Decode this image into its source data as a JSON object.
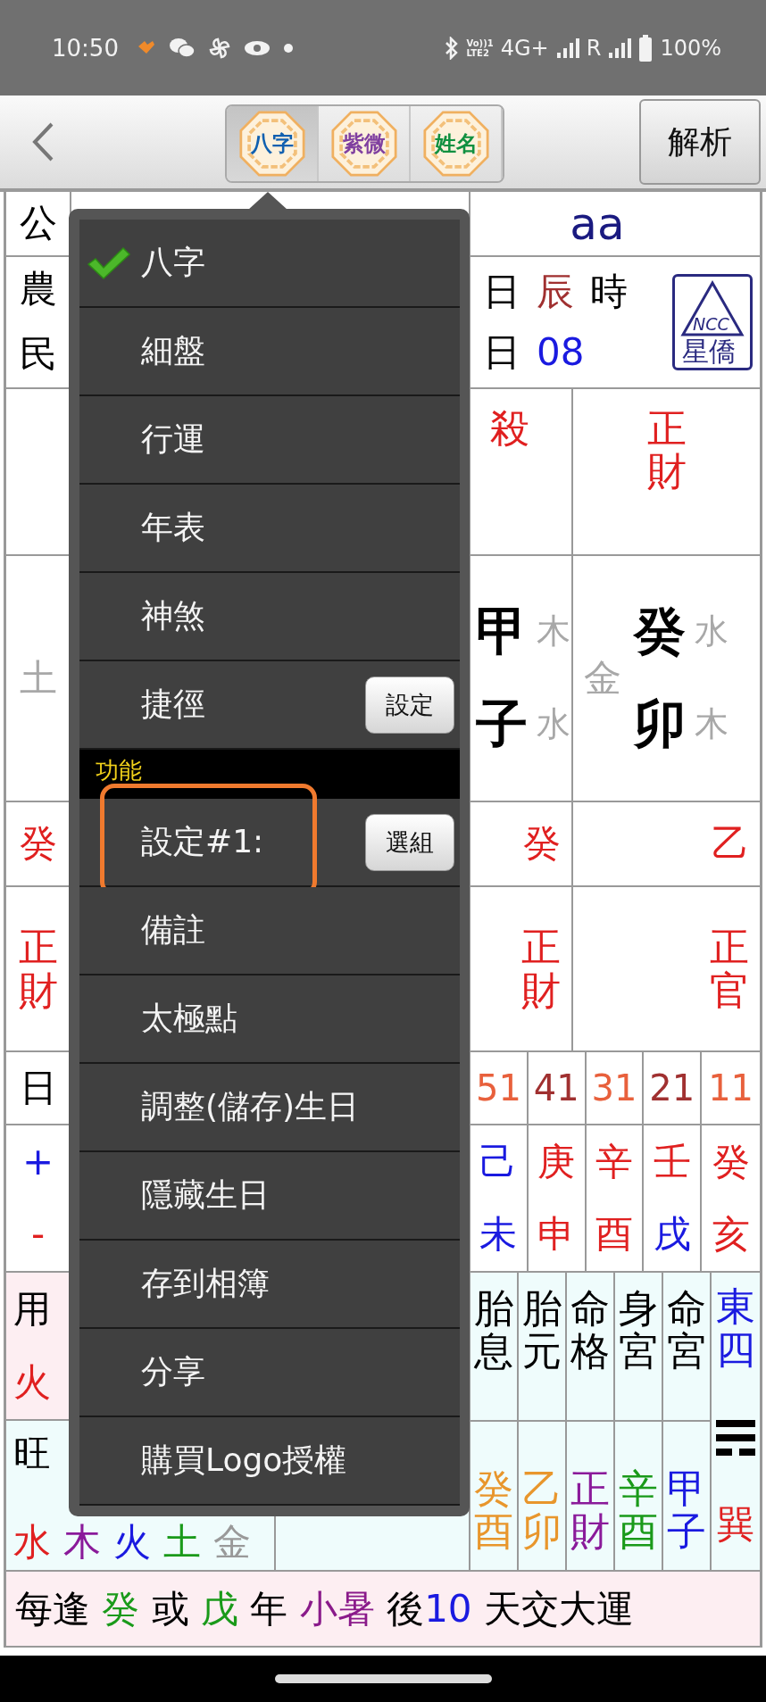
{
  "status_bar": {
    "time": "10:50",
    "volte": [
      "Vo))1",
      "LTE2"
    ],
    "network": "4G+",
    "roaming": "R",
    "battery": "100%"
  },
  "toolbar": {
    "tabs": [
      {
        "label": "八字",
        "color": "#1060b0",
        "selected": true
      },
      {
        "label": "紫微",
        "color": "#8040a0",
        "selected": false
      },
      {
        "label": "姓名",
        "color": "#109040",
        "selected": false
      }
    ],
    "analyze_button": "解析"
  },
  "chart": {
    "name": "aa",
    "calendar_labels": [
      "公",
      "農",
      "民"
    ],
    "lunar_cells": [
      {
        "text": "日"
      },
      {
        "text": "辰",
        "color": "#a03030"
      },
      {
        "text": "時"
      }
    ],
    "roc_cells": [
      {
        "text": "日"
      },
      {
        "text": "08",
        "color": "#1a1ae0"
      }
    ],
    "logo": {
      "top": "NCC",
      "bottom": "星僑"
    },
    "ten_gods": [
      "殺",
      "正財"
    ],
    "left_element": "土",
    "pillars": [
      {
        "stem": "甲",
        "stem_element": "木",
        "branch": "子",
        "branch_element": "水"
      },
      {
        "side_element": "金",
        "stem": "癸",
        "stem_element": "水",
        "branch": "卯",
        "branch_element": "木"
      }
    ],
    "hidden_stems": {
      "left": "癸",
      "cells": [
        "癸",
        "乙"
      ]
    },
    "hidden_gods": {
      "left": "正財",
      "cells": [
        "正財",
        "正官"
      ]
    },
    "luck": {
      "left": "日",
      "signs": [
        {
          "text": "+",
          "color": "#1a1ae0"
        },
        {
          "text": "-",
          "color": "#e02020"
        }
      ],
      "ages": [
        {
          "text": "51",
          "color": "#e8603c"
        },
        {
          "text": "41",
          "color": "#a03030"
        },
        {
          "text": "31",
          "color": "#e8603c"
        },
        {
          "text": "21",
          "color": "#a03030"
        },
        {
          "text": "11",
          "color": "#e8603c"
        }
      ],
      "pillars": [
        {
          "stem": {
            "text": "己",
            "color": "#1a1ae0"
          },
          "branch": {
            "text": "未",
            "color": "#1a1ae0"
          }
        },
        {
          "stem": {
            "text": "庚",
            "color": "#e02020"
          },
          "branch": {
            "text": "申",
            "color": "#e02020"
          }
        },
        {
          "stem": {
            "text": "辛",
            "color": "#e02020"
          },
          "branch": {
            "text": "酉",
            "color": "#e02020"
          }
        },
        {
          "stem": {
            "text": "壬",
            "color": "#e02020"
          },
          "branch": {
            "text": "戌",
            "color": "#1a1ae0"
          }
        },
        {
          "stem": {
            "text": "癸",
            "color": "#e02020"
          },
          "branch": {
            "text": "亥",
            "color": "#e02020"
          }
        }
      ]
    },
    "extra": {
      "use_label": "用",
      "use_value": "火",
      "strong_label": "旺",
      "elements": [
        {
          "text": "水",
          "color": "#e02020"
        },
        {
          "text": "木",
          "color": "#8a1a9a"
        },
        {
          "text": "火",
          "color": "#1a1ae0"
        },
        {
          "text": "土",
          "color": "#1a9a1a"
        },
        {
          "text": "金",
          "color": "#999999"
        }
      ],
      "labels": [
        "胎息",
        "胎元",
        "命格",
        "身宮",
        "命宮"
      ],
      "values": [
        {
          "text": "癸酉",
          "color": "#e8962c"
        },
        {
          "text": "乙卯",
          "color": "#e8962c"
        },
        {
          "text": "正財",
          "color": "#8a1a9a"
        },
        {
          "text": "辛酉",
          "color": "#1a9a1a"
        },
        {
          "text": "甲子",
          "color": "#1a1ae0"
        }
      ],
      "direction": "東四",
      "trigram_name": "巽"
    },
    "footer": [
      {
        "text": "每逢 "
      },
      {
        "text": "癸",
        "color": "#1a9a1a"
      },
      {
        "text": " 或 "
      },
      {
        "text": "戊",
        "color": "#1a9a1a"
      },
      {
        "text": " 年 "
      },
      {
        "text": "小暑",
        "color": "#8a1a8a"
      },
      {
        "text": " 後"
      },
      {
        "text": "10",
        "color": "#1a1ae0"
      },
      {
        "text": " 天交大運"
      }
    ]
  },
  "menu": {
    "items": [
      {
        "kind": "item",
        "label": "八字",
        "checked": true,
        "highlighted": false
      },
      {
        "kind": "item",
        "label": "細盤",
        "checked": false,
        "highlighted": false
      },
      {
        "kind": "item",
        "label": "行運",
        "checked": false,
        "highlighted": false
      },
      {
        "kind": "item",
        "label": "年表",
        "checked": false,
        "highlighted": false
      },
      {
        "kind": "item",
        "label": "神煞",
        "checked": false,
        "highlighted": false
      },
      {
        "kind": "item",
        "label": "捷徑",
        "button": "設定",
        "checked": false,
        "highlighted": false
      },
      {
        "kind": "section",
        "label": "功能"
      },
      {
        "kind": "item",
        "label": "設定#1:",
        "button": "選組",
        "checked": false,
        "highlighted": true
      },
      {
        "kind": "item",
        "label": "備註",
        "checked": false,
        "highlighted": false
      },
      {
        "kind": "item",
        "label": "太極點",
        "checked": false,
        "highlighted": false
      },
      {
        "kind": "item",
        "label": "調整(儲存)生日",
        "checked": false,
        "highlighted": false
      },
      {
        "kind": "item",
        "label": "隱藏生日",
        "checked": false,
        "highlighted": false
      },
      {
        "kind": "item",
        "label": "存到相簿",
        "checked": false,
        "highlighted": false
      },
      {
        "kind": "item",
        "label": "分享",
        "checked": false,
        "highlighted": false
      },
      {
        "kind": "item",
        "label": "購買Logo授權",
        "checked": false,
        "highlighted": false
      }
    ]
  }
}
